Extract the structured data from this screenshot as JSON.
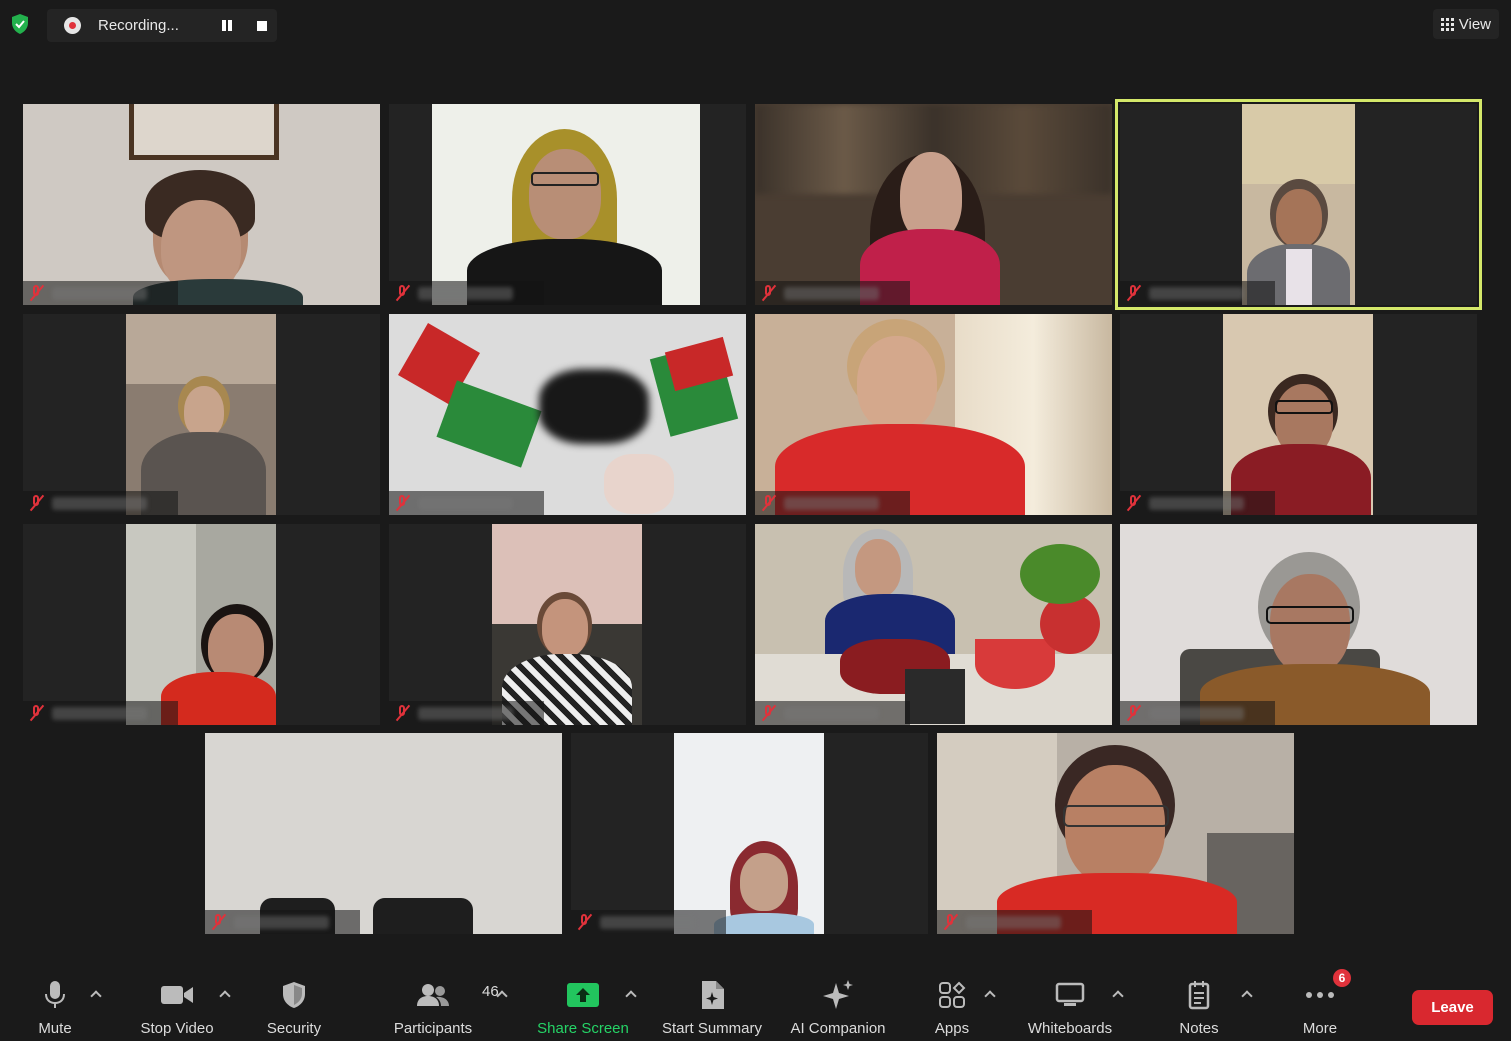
{
  "topbar": {
    "recording_label": "Recording...",
    "view_label": "View"
  },
  "toolbar": {
    "mute_label": "Mute",
    "video_label": "Stop Video",
    "security_label": "Security",
    "participants_label": "Participants",
    "participants_count": "46",
    "share_label": "Share Screen",
    "summary_label": "Start Summary",
    "ai_label": "AI Companion",
    "apps_label": "Apps",
    "whiteboards_label": "Whiteboards",
    "notes_label": "Notes",
    "more_label": "More",
    "more_badge": "6",
    "leave_label": "Leave"
  },
  "colors": {
    "accent_green": "#25d366",
    "leave_red": "#d9282f",
    "active_speaker_border": "#d4e86a",
    "muted_red": "#e0323b"
  }
}
